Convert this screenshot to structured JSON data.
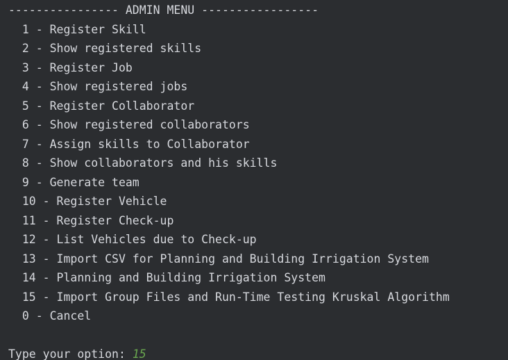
{
  "console": {
    "header": "---------------- ADMIN MENU -----------------",
    "menu_items": [
      "  1 - Register Skill",
      "  2 - Show registered skills",
      "  3 - Register Job",
      "  4 - Show registered jobs",
      "  5 - Register Collaborator",
      "  6 - Show registered collaborators",
      "  7 - Assign skills to Collaborator",
      "  8 - Show collaborators and his skills",
      "  9 - Generate team",
      "  10 - Register Vehicle",
      "  11 - Register Check-up",
      "  12 - List Vehicles due to Check-up",
      "  13 - Import CSV for Planning and Building Irrigation System",
      "  14 - Planning and Building Irrigation System",
      "  15 - Import Group Files and Run-Time Testing Kruskal Algorithm",
      "  0 - Cancel"
    ],
    "prompt_label": "Type your option: ",
    "prompt_value": "15"
  },
  "colors": {
    "background": "#2b2d30",
    "text": "#d7d9de",
    "input": "#6aa84f"
  }
}
